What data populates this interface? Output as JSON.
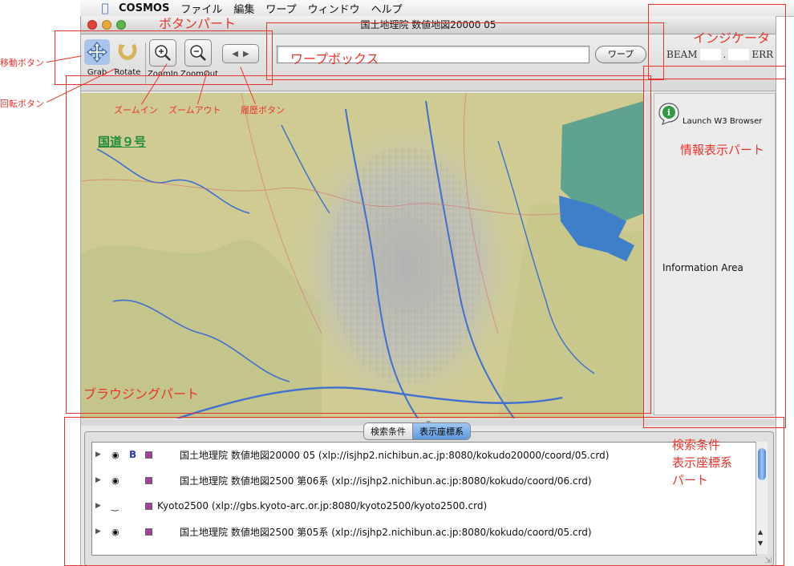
{
  "menubar": {
    "app_name": "COSMOS",
    "items": [
      "ファイル",
      "編集",
      "ワープ",
      "ウィンドウ",
      "ヘルプ"
    ]
  },
  "window": {
    "title": "国土地理院 数値地図20000 05"
  },
  "toolbar": {
    "buttons": [
      {
        "label": "Grab",
        "icon": "move-arrows-icon"
      },
      {
        "label": "Rotate",
        "icon": "rotate-icon"
      },
      {
        "label": "ZoomIn",
        "icon": "zoom-in-icon"
      },
      {
        "label": "ZoomOut",
        "icon": "zoom-out-icon"
      }
    ],
    "warp_value": "",
    "warp_button": "ワープ",
    "indicator": {
      "beam": "BEAM",
      "sep": ".",
      "err": "ERR"
    }
  },
  "map": {
    "road_label": "国道９号"
  },
  "info_panel": {
    "launch_label": "Launch W3 Browser",
    "info_area": "Information Area"
  },
  "bottom": {
    "tabs": [
      "検索条件",
      "表示座標系"
    ],
    "active_tab": 1,
    "rows": [
      {
        "b": "B",
        "text": "国土地理院 数値地図20000 05 (xlp://isjhp2.nichibun.ac.jp:8080/kokudo20000/coord/05.crd)"
      },
      {
        "b": "",
        "text": "国土地理院 数値地図2500 第06系 (xlp://isjhp2.nichibun.ac.jp:8080/kokudo/coord/06.crd)"
      },
      {
        "b": "",
        "text": "Kyoto2500 (xlp://gbs.kyoto-arc.or.jp:8080/kyoto2500/kyoto2500.crd)"
      },
      {
        "b": "",
        "text": "国土地理院 数値地図2500 第05系 (xlp://isjhp2.nichibun.ac.jp:8080/kokudo/coord/05.crd)"
      }
    ]
  },
  "annotations": {
    "button_part": "ボタンパート",
    "move_button": "移動ボタン",
    "rotate_button": "回転ボタン",
    "zoom_in": "ズームイン",
    "zoom_out": "ズームアウト",
    "history_button": "履歴ボタン",
    "warp_box": "ワープボックス",
    "indicator": "インジケータ",
    "info_part": "情報表示パート",
    "browsing_part": "ブラウジングパート",
    "search_part_1": "検索条件",
    "search_part_2": "表示座標系",
    "search_part_3": "パート"
  },
  "colors": {
    "annotation": "#e8352c",
    "road_label": "#1f8a3a",
    "water": "#3f7ec9",
    "sea": "#4f9a8a"
  }
}
